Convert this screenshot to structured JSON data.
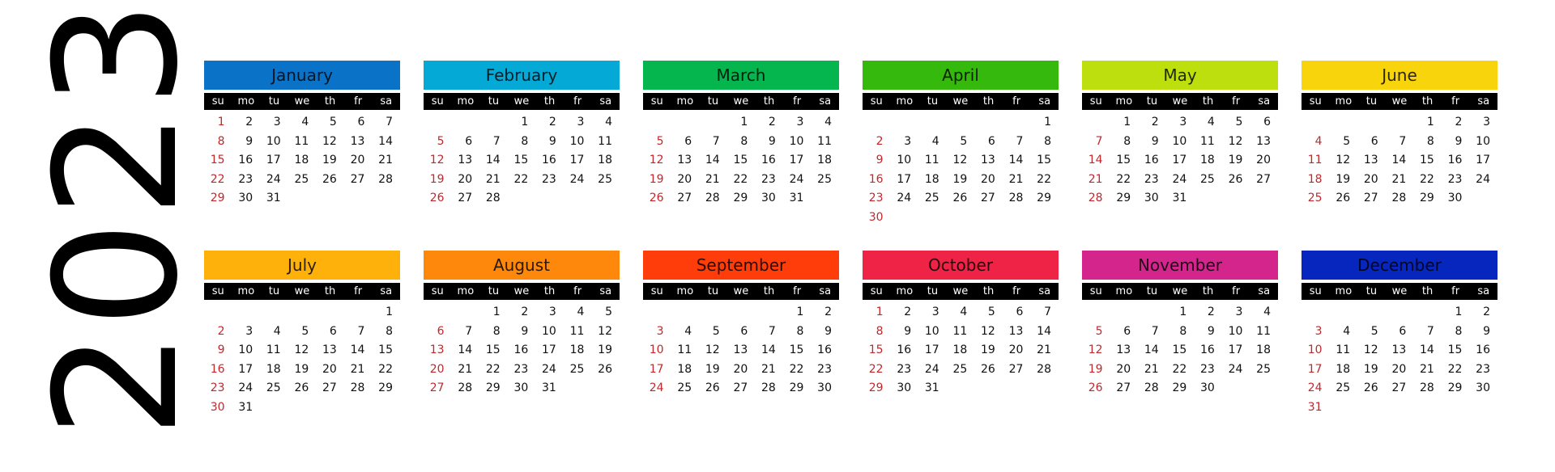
{
  "year": "2023",
  "weekdays": [
    "su",
    "mo",
    "tu",
    "we",
    "th",
    "fr",
    "sa"
  ],
  "sunday_color": "#c0282d",
  "months": [
    {
      "name": "January",
      "color": "#0a73c8",
      "start": 0,
      "days": 31
    },
    {
      "name": "February",
      "color": "#04a9d6",
      "start": 3,
      "days": 28
    },
    {
      "name": "March",
      "color": "#05b64f",
      "start": 3,
      "days": 31
    },
    {
      "name": "April",
      "color": "#36b90d",
      "start": 6,
      "days": 30
    },
    {
      "name": "May",
      "color": "#bddf0e",
      "start": 1,
      "days": 31
    },
    {
      "name": "June",
      "color": "#f7d40b",
      "start": 4,
      "days": 30
    },
    {
      "name": "July",
      "color": "#fdb10a",
      "start": 6,
      "days": 31
    },
    {
      "name": "August",
      "color": "#fe880b",
      "start": 2,
      "days": 31
    },
    {
      "name": "September",
      "color": "#fe3d0b",
      "start": 5,
      "days": 30
    },
    {
      "name": "October",
      "color": "#ef2346",
      "start": 0,
      "days": 31
    },
    {
      "name": "November",
      "color": "#d4258d",
      "start": 3,
      "days": 30
    },
    {
      "name": "December",
      "color": "#0626bd",
      "start": 5,
      "days": 31
    }
  ]
}
